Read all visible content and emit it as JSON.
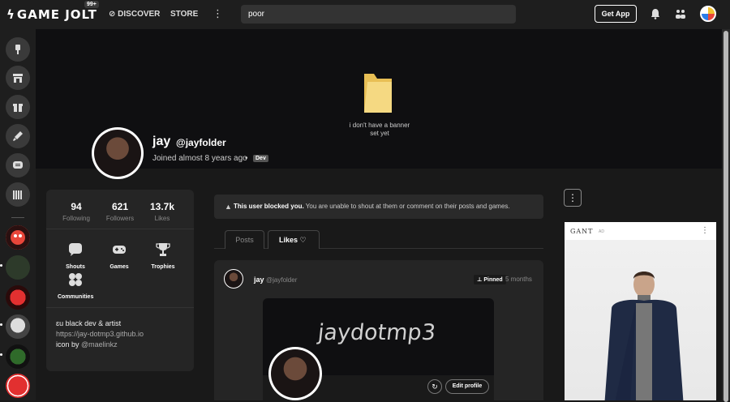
{
  "topbar": {
    "logo": "GAME JOLT",
    "notification_count": "99+",
    "discover_label": "DISCOVER",
    "store_label": "STORE",
    "more_label": "⋮",
    "search_value": "poor",
    "get_app_label": "Get App"
  },
  "banner": {
    "empty_text": "i don't have a banner set yet"
  },
  "profile": {
    "display_name": "jay",
    "username": "@jayfolder",
    "joined": "Joined almost 8 years ago",
    "separator": "•",
    "badge": "Dev"
  },
  "stats": [
    {
      "value": "94",
      "label": "Following"
    },
    {
      "value": "621",
      "label": "Followers"
    },
    {
      "value": "13.7k",
      "label": "Likes"
    }
  ],
  "tiles": [
    {
      "label": "Shouts",
      "icon": "shouts-icon"
    },
    {
      "label": "Games",
      "icon": "gamepad-icon"
    },
    {
      "label": "Trophies",
      "icon": "trophy-icon"
    },
    {
      "label": "Communities",
      "icon": "communities-icon"
    }
  ],
  "bio": {
    "line1": "ɛu black dev & artist",
    "link": "https://jay-dotmp3.github.io",
    "line3_prefix": "icon by ",
    "line3_mention": "@maelinkz"
  },
  "blocked_notice": {
    "bold": "This user blocked you.",
    "rest": " You are unable to shout at them or comment on their posts and games."
  },
  "tabs": {
    "posts": "Posts",
    "likes": "Likes"
  },
  "post": {
    "name": "jay",
    "handle": "@jayfolder",
    "pinned": "Pinned",
    "time": "5 months",
    "embed_title": "jaydotmp3",
    "edit_profile": "Edit profile"
  },
  "side_more_label": "⋮",
  "ad": {
    "brand": "GANT",
    "tag": "AD",
    "menu": "⋮"
  },
  "colors": {
    "background": "#191919",
    "card": "#252525",
    "topbar": "#1e1e1e",
    "folder": "#f2d27a"
  }
}
